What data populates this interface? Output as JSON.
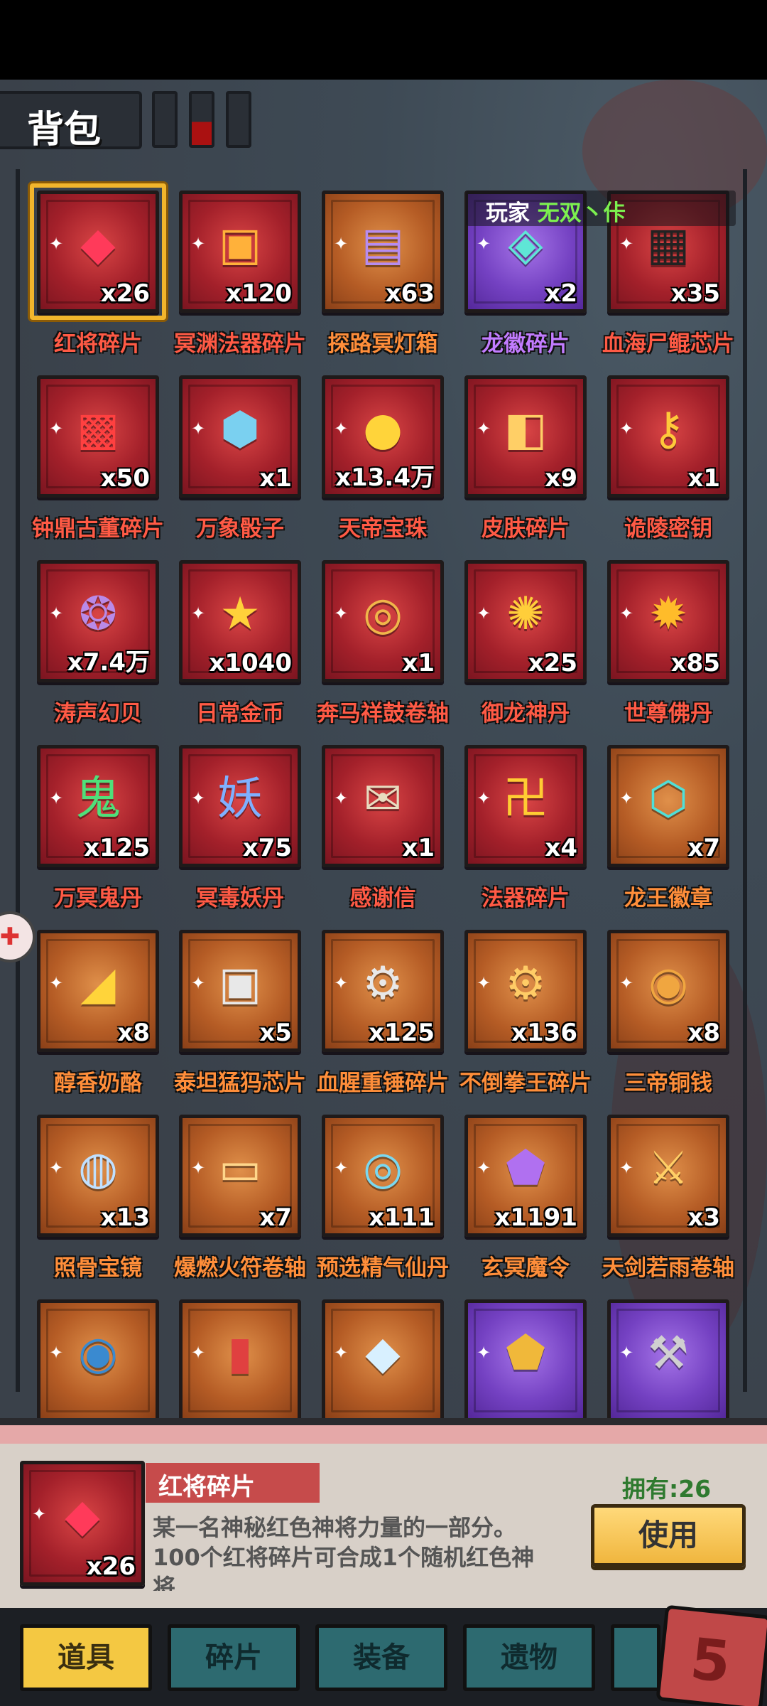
{
  "header": {
    "title": "背包"
  },
  "player": {
    "label": "玩家",
    "name": "无双丶佧"
  },
  "items": [
    {
      "name": "红将碎片",
      "qty": "x26",
      "rarity": "red",
      "icon": "red-gem-icon",
      "glyph": "◆",
      "color": "#ff3a5a"
    },
    {
      "name": "冥渊法器碎片",
      "qty": "x120",
      "rarity": "red",
      "icon": "treasure-box-icon",
      "glyph": "▣",
      "color": "#ffb13a"
    },
    {
      "name": "探路冥灯箱",
      "qty": "x63",
      "rarity": "orange",
      "icon": "lantern-chest-icon",
      "glyph": "▤",
      "color": "#b68cf0"
    },
    {
      "name": "龙徽碎片",
      "qty": "x2",
      "rarity": "purple",
      "icon": "dragon-emblem-shard-icon",
      "glyph": "◈",
      "color": "#5fe6d6"
    },
    {
      "name": "血海尸鲲芯片",
      "qty": "x35",
      "rarity": "red",
      "icon": "monster-chip-icon",
      "glyph": "▦",
      "color": "#222222"
    },
    {
      "name": "钟鼎古董碎片",
      "qty": "x50",
      "rarity": "red",
      "icon": "antique-fragment-icon",
      "glyph": "▩",
      "color": "#ff4040"
    },
    {
      "name": "万象骰子",
      "qty": "x1",
      "rarity": "red",
      "icon": "dice-icon",
      "glyph": "⬢",
      "color": "#7ad0f0"
    },
    {
      "name": "天帝宝珠",
      "qty": "x13.4万",
      "rarity": "red",
      "icon": "golden-orb-icon",
      "glyph": "●",
      "color": "#ffd43a"
    },
    {
      "name": "皮肤碎片",
      "qty": "x9",
      "rarity": "red",
      "icon": "skin-shard-icon",
      "glyph": "◧",
      "color": "#ffcf66"
    },
    {
      "name": "诡陵密钥",
      "qty": "x1",
      "rarity": "red",
      "icon": "key-icon",
      "glyph": "⚷",
      "color": "#ffc93a"
    },
    {
      "name": "涛声幻贝",
      "qty": "x7.4万",
      "rarity": "red",
      "icon": "shell-icon",
      "glyph": "❂",
      "color": "#b98ae8"
    },
    {
      "name": "日常金币",
      "qty": "x1040",
      "rarity": "red",
      "icon": "gold-coin-icon",
      "glyph": "★",
      "color": "#ffd13a"
    },
    {
      "name": "奔马祥鼓卷轴",
      "qty": "x1",
      "rarity": "red",
      "icon": "scroll-icon",
      "glyph": "◎",
      "color": "#f0b64a"
    },
    {
      "name": "御龙神丹",
      "qty": "x25",
      "rarity": "red",
      "icon": "dragon-pill-icon",
      "glyph": "✺",
      "color": "#ffce3a"
    },
    {
      "name": "世尊佛丹",
      "qty": "x85",
      "rarity": "red",
      "icon": "buddha-pill-icon",
      "glyph": "✹",
      "color": "#ffbc2a"
    },
    {
      "name": "万冥鬼丹",
      "qty": "x125",
      "rarity": "red",
      "icon": "ghost-pill-icon",
      "glyph": "鬼",
      "color": "#4fe07a"
    },
    {
      "name": "冥毒妖丹",
      "qty": "x75",
      "rarity": "red",
      "icon": "demon-pill-icon",
      "glyph": "妖",
      "color": "#7fb0ff"
    },
    {
      "name": "感谢信",
      "qty": "x1",
      "rarity": "red",
      "icon": "letter-icon",
      "glyph": "✉",
      "color": "#e8dcc0"
    },
    {
      "name": "法器碎片",
      "qty": "x4",
      "rarity": "red",
      "icon": "artifact-shard-icon",
      "glyph": "卍",
      "color": "#ffcc33"
    },
    {
      "name": "龙王徽章",
      "qty": "x7",
      "rarity": "orange",
      "icon": "dragon-badge-icon",
      "glyph": "⬡",
      "color": "#4fe0d8"
    },
    {
      "name": "醇香奶酪",
      "qty": "x8",
      "rarity": "orange",
      "icon": "cheese-icon",
      "glyph": "◢",
      "color": "#ffd43a"
    },
    {
      "name": "泰坦猛犸芯片",
      "qty": "x5",
      "rarity": "orange",
      "icon": "mammoth-chip-icon",
      "glyph": "▣",
      "color": "#e8e8e8"
    },
    {
      "name": "血腥重锤碎片",
      "qty": "x125",
      "rarity": "orange",
      "icon": "hammer-shard-icon",
      "glyph": "⚙",
      "color": "#e8e8e8"
    },
    {
      "name": "不倒拳王碎片",
      "qty": "x136",
      "rarity": "orange",
      "icon": "boxer-shard-icon",
      "glyph": "⚙",
      "color": "#ffcc66"
    },
    {
      "name": "三帝铜钱",
      "qty": "x8",
      "rarity": "orange",
      "icon": "copper-coins-icon",
      "glyph": "◉",
      "color": "#f0a640"
    },
    {
      "name": "照骨宝镜",
      "qty": "x13",
      "rarity": "orange",
      "icon": "mirror-icon",
      "glyph": "◍",
      "color": "#c0e0ff"
    },
    {
      "name": "爆燃火符卷轴",
      "qty": "x7",
      "rarity": "orange",
      "icon": "fire-scroll-icon",
      "glyph": "▭",
      "color": "#ffd68a"
    },
    {
      "name": "预选精气仙丹",
      "qty": "x111",
      "rarity": "orange",
      "icon": "spirit-pill-icon",
      "glyph": "◎",
      "color": "#7ad8f0"
    },
    {
      "name": "玄冥魔令",
      "qty": "x1191",
      "rarity": "orange",
      "icon": "demon-token-icon",
      "glyph": "⬟",
      "color": "#b070f0"
    },
    {
      "name": "天剑若雨卷轴",
      "qty": "x3",
      "rarity": "orange",
      "icon": "sword-scroll-icon",
      "glyph": "⚔",
      "color": "#ffcf66"
    },
    {
      "name": "",
      "qty": "",
      "rarity": "orange",
      "icon": "vase-medal-icon",
      "glyph": "◉",
      "color": "#3a8ad0"
    },
    {
      "name": "",
      "qty": "",
      "rarity": "orange",
      "icon": "banner-scroll-icon",
      "glyph": "▮",
      "color": "#e04040"
    },
    {
      "name": "",
      "qty": "",
      "rarity": "orange",
      "icon": "crystal-icon",
      "glyph": "◆",
      "color": "#d8f0ff"
    },
    {
      "name": "",
      "qty": "",
      "rarity": "purple",
      "icon": "shield-icon",
      "glyph": "⬟",
      "color": "#f0b83a"
    },
    {
      "name": "",
      "qty": "",
      "rarity": "purple",
      "icon": "axe-emblem-icon",
      "glyph": "⚒",
      "color": "#d0d0d0"
    }
  ],
  "selected": {
    "name": "红将碎片",
    "qty": "x26",
    "owned": "拥有:26",
    "desc_line1": "某一名神秘红色神将力量的一部分。",
    "desc_line2": "100个红将碎片可合成1个随机红色神",
    "desc_line3": "将",
    "use_label": "使用"
  },
  "tabs": [
    {
      "label": "道具",
      "active": true
    },
    {
      "label": "碎片",
      "active": false
    },
    {
      "label": "装备",
      "active": false
    },
    {
      "label": "遗物",
      "active": false
    }
  ]
}
